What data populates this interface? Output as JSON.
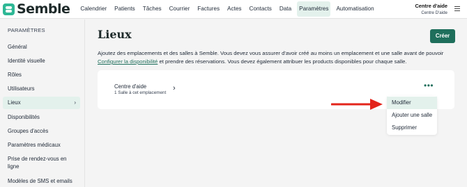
{
  "brand": {
    "name": "Semble"
  },
  "nav": {
    "items": [
      "Calendrier",
      "Patients",
      "Tâches",
      "Courrier",
      "Factures",
      "Actes",
      "Contacts",
      "Data",
      "Paramètres",
      "Automatisation"
    ],
    "active_index": 8
  },
  "user": {
    "name": "Centre d'aide",
    "subtitle": "Centre D'aide"
  },
  "sidebar": {
    "title": "PARAMÈTRES",
    "items": [
      {
        "label": "Général"
      },
      {
        "label": "Identité visuelle"
      },
      {
        "label": "Rôles"
      },
      {
        "label": "Utilisateurs"
      },
      {
        "label": "Lieux",
        "active": true
      },
      {
        "label": "Disponibilités"
      },
      {
        "label": "Groupes d'accès"
      },
      {
        "label": "Paramètres médicaux"
      },
      {
        "label": "Prise de rendez-vous en ligne"
      },
      {
        "label": "Modèles de SMS et emails"
      }
    ]
  },
  "main": {
    "title": "Lieux",
    "create_button": "Créer",
    "intro_before": "Ajoutez des emplacements et des salles à Semble. Vous devez vous assurer d'avoir créé au moins un emplacement et une salle avant de pouvoir ",
    "intro_link": "Configurer la disponibilité",
    "intro_after": " et prendre des réservations. Vous devez également attribuer les products disponibles pour chaque salle."
  },
  "location": {
    "name": "Centre d'aide",
    "detail": "1 Salle à cet emplacement"
  },
  "dropdown": {
    "items": [
      "Modifier",
      "Ajouter une salle",
      "Supprimer"
    ],
    "highlighted_index": 0
  },
  "colors": {
    "accent": "#1f6f5c",
    "active_bg": "#e3f1ec",
    "arrow": "#e3241b",
    "brand": "#2fb896"
  },
  "icons": {
    "menu": "hamburger-icon",
    "chevron": "chevron-right-icon",
    "more": "more-horizontal-icon"
  }
}
